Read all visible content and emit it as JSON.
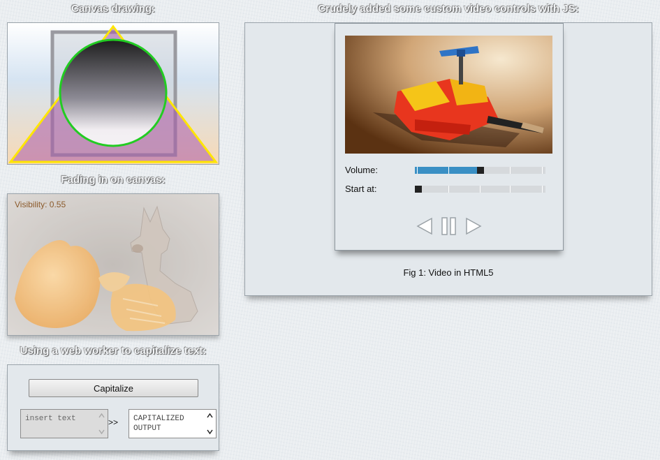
{
  "headings": {
    "canvas_drawing": "Canvas drawing:",
    "fading": "Fading in on canvas:",
    "worker": "Using a web worker to capitalize text:",
    "video": "Crudely added some custom video controls with JS:"
  },
  "fading": {
    "visibility_label": "Visibility: 0.55"
  },
  "worker": {
    "button_label": "Capitalize",
    "input_placeholder": "insert text",
    "arrow_text": ">>",
    "output_value": "CAPITALIZED OUTPUT"
  },
  "video": {
    "volume_label": "Volume:",
    "start_label": "Start at:",
    "volume_level": 0.5,
    "start_level": 0.0,
    "caption": "Fig 1: Video in HTML5",
    "icons": [
      "previous-icon",
      "pause-icon",
      "next-icon"
    ]
  },
  "colors": {
    "accent": "#3a8fc4",
    "circle": "#22cc22",
    "triangle": "#ffe600"
  }
}
